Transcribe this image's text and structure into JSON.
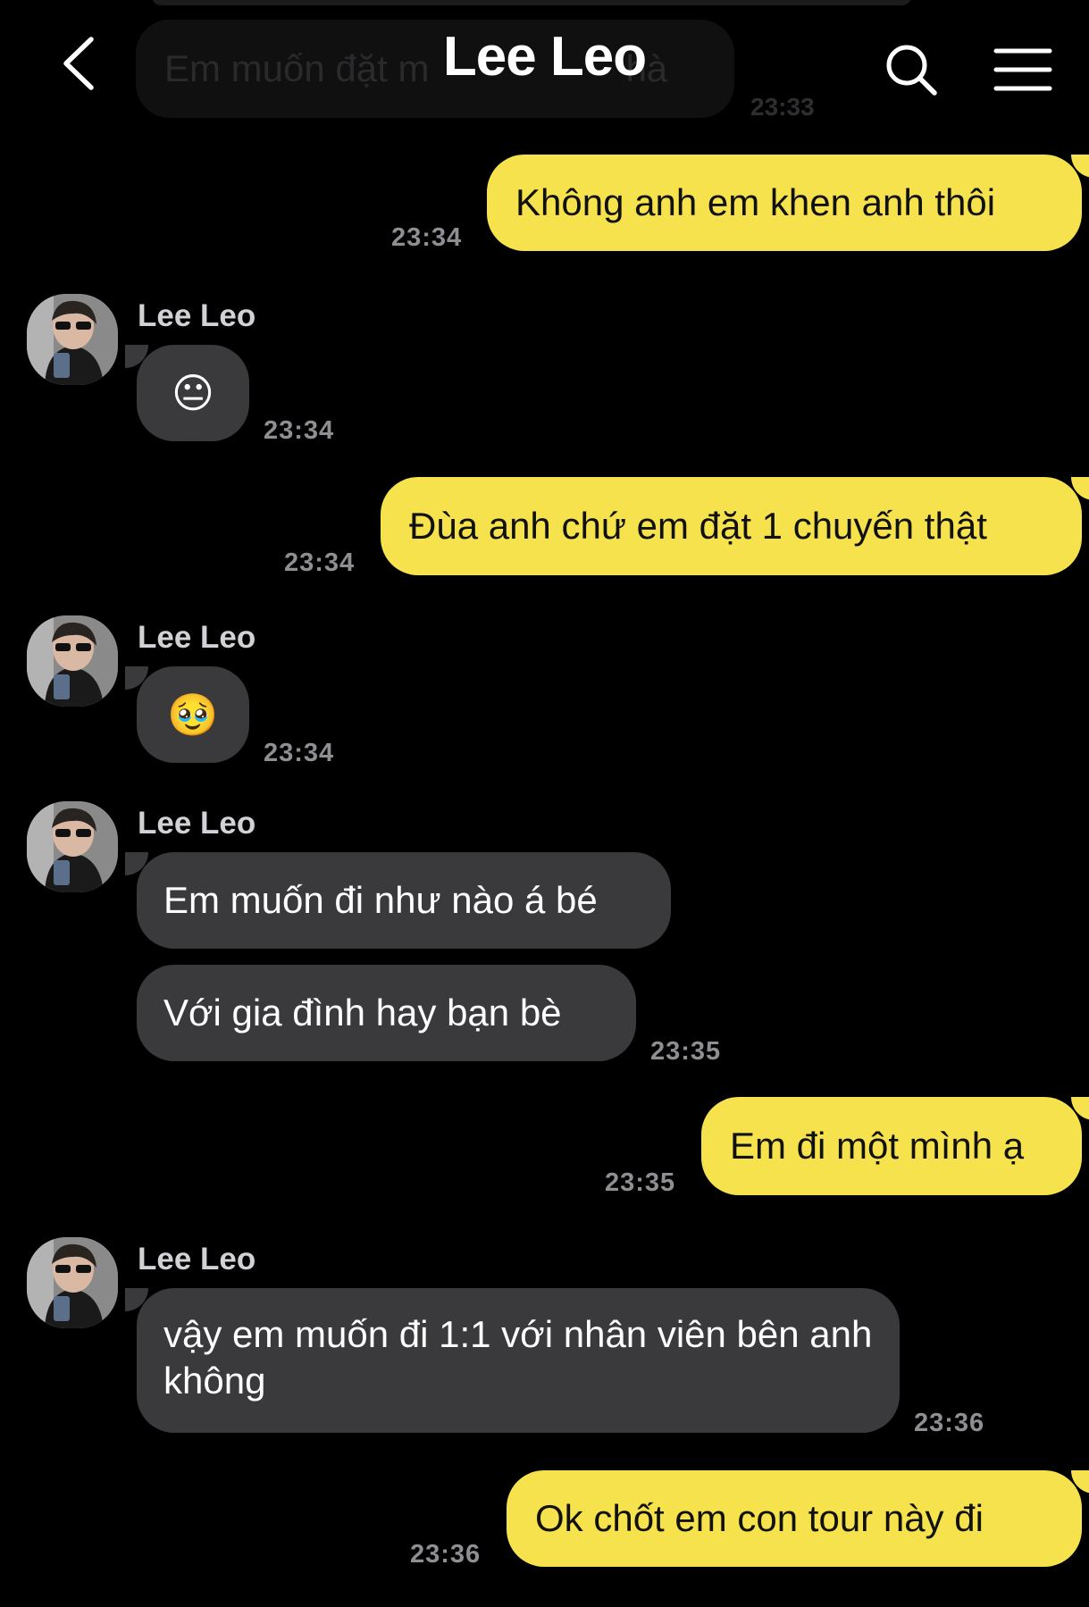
{
  "header": {
    "title": "Lee Leo",
    "back_icon": "chevron-left-icon",
    "search_icon": "search-icon",
    "menu_icon": "hamburger-menu-icon"
  },
  "ghost": {
    "text": "Em muốn đặt m",
    "text_tail": "hà",
    "time": "23:33"
  },
  "colors": {
    "background": "#000000",
    "my_bubble": "#f6e24c",
    "their_bubble": "#3a3a3c",
    "timestamp": "#8e8e93"
  },
  "messages": [
    {
      "from": "me",
      "text": "Không anh em khen anh thôi",
      "time": "23:34"
    },
    {
      "from": "them",
      "sender": "Lee Leo",
      "text": "😐",
      "time": "23:34"
    },
    {
      "from": "me",
      "text": "Đùa anh chứ em đặt 1 chuyến thật",
      "time": "23:34"
    },
    {
      "from": "them",
      "sender": "Lee Leo",
      "text": "🥹",
      "time": "23:34"
    },
    {
      "from": "them",
      "sender": "Lee Leo",
      "text": "Em muốn đi như nào á bé"
    },
    {
      "from": "them",
      "text": "Với gia đình hay bạn bè",
      "time": "23:35"
    },
    {
      "from": "me",
      "text": "Em đi một mình ạ",
      "time": "23:35"
    },
    {
      "from": "them",
      "sender": "Lee Leo",
      "text": "vậy em muốn đi 1:1 với nhân viên bên anh không",
      "time": "23:36"
    },
    {
      "from": "me",
      "text": "Ok chốt em con tour này đi",
      "time": "23:36"
    }
  ]
}
